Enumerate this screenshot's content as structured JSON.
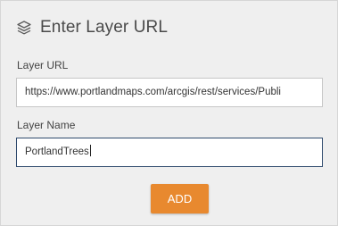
{
  "panel": {
    "title": "Enter Layer URL",
    "icon": "layers-icon"
  },
  "layer_url": {
    "label": "Layer URL",
    "value": "https://www.portlandmaps.com/arcgis/rest/services/Publi"
  },
  "layer_name": {
    "label": "Layer Name",
    "value": "PortlandTrees"
  },
  "add_button": {
    "label": "ADD",
    "color": "#e8892f"
  },
  "colors": {
    "panel_bg": "#efefef",
    "focus_border": "#2f4a6d"
  }
}
